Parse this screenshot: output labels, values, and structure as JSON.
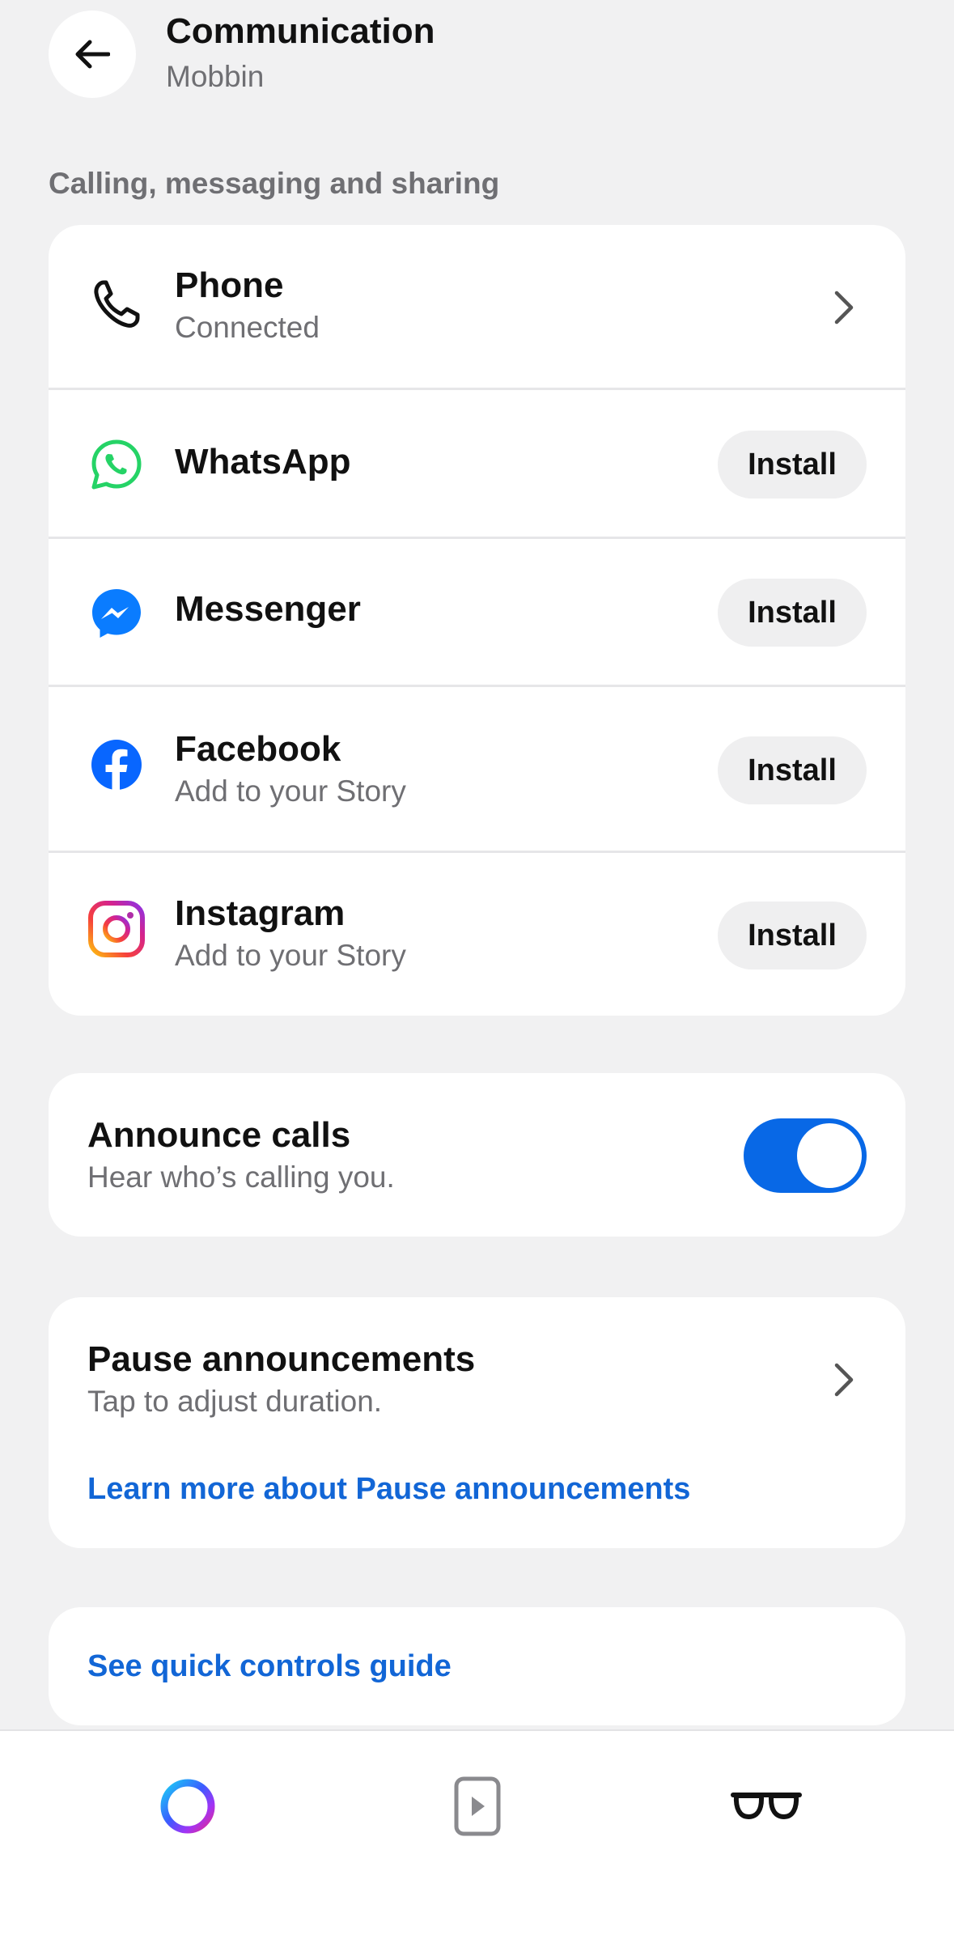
{
  "header": {
    "title": "Communication",
    "subtitle": "Mobbin",
    "back_icon": "arrow-left-icon"
  },
  "section_label": "Calling, messaging and sharing",
  "apps": [
    {
      "name": "Phone",
      "status": "Connected",
      "icon": "phone-icon",
      "action": "chevron"
    },
    {
      "name": "WhatsApp",
      "icon": "whatsapp-icon",
      "action": "Install"
    },
    {
      "name": "Messenger",
      "icon": "messenger-icon",
      "action": "Install"
    },
    {
      "name": "Facebook",
      "status": "Add to your Story",
      "icon": "facebook-icon",
      "action": "Install"
    },
    {
      "name": "Instagram",
      "status": "Add to your Story",
      "icon": "instagram-icon",
      "action": "Install"
    }
  ],
  "announce_calls": {
    "title": "Announce calls",
    "subtitle": "Hear who’s calling you.",
    "enabled": true
  },
  "pause_announcements": {
    "title": "Pause announcements",
    "subtitle": "Tap to adjust duration.",
    "link": "Learn more about Pause announcements"
  },
  "quick_controls": {
    "link": "See quick controls guide"
  },
  "bottom_nav": [
    {
      "icon": "meta-ai-ring-icon"
    },
    {
      "icon": "media-play-icon"
    },
    {
      "icon": "glasses-icon"
    }
  ],
  "colors": {
    "background": "#f1f1f2",
    "accent_blue": "#0868e6",
    "link_blue": "#1266d6",
    "whatsapp_green": "#25d366",
    "messenger_blue": "#0a7cff",
    "facebook_blue": "#0866ff"
  }
}
